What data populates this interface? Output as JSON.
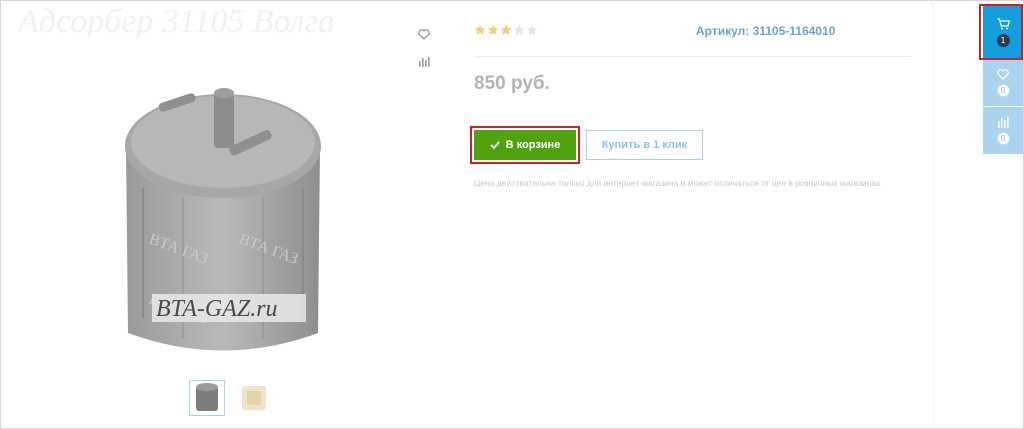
{
  "product": {
    "title_ghost": "Адсорбер 31105 Волга",
    "rating": {
      "value": 3,
      "max": 5
    },
    "sku_label": "Артикул: 31105-1164010",
    "price": "850 руб.",
    "watermark": "BTA-GAZ.ru"
  },
  "actions": {
    "cart_button": "В корзине",
    "one_click_button": "Купить в 1 клик"
  },
  "note": "Цена действительна только для интернет-магазина и может отличаться от цен в розничных магазинах",
  "side_panel": {
    "cart_count": "1",
    "wishlist_count": "0",
    "compare_count": "0"
  },
  "icons": {
    "favorite": "heart-icon",
    "compare": "bar-chart-icon",
    "cart": "cart-icon",
    "check": "check-icon"
  },
  "colors": {
    "accent_blue": "#139ee0",
    "light_blue": "#a9d3ef",
    "cart_green": "#4ea30f",
    "highlight_red": "#c8232c",
    "star_gold": "#f3cf74"
  }
}
